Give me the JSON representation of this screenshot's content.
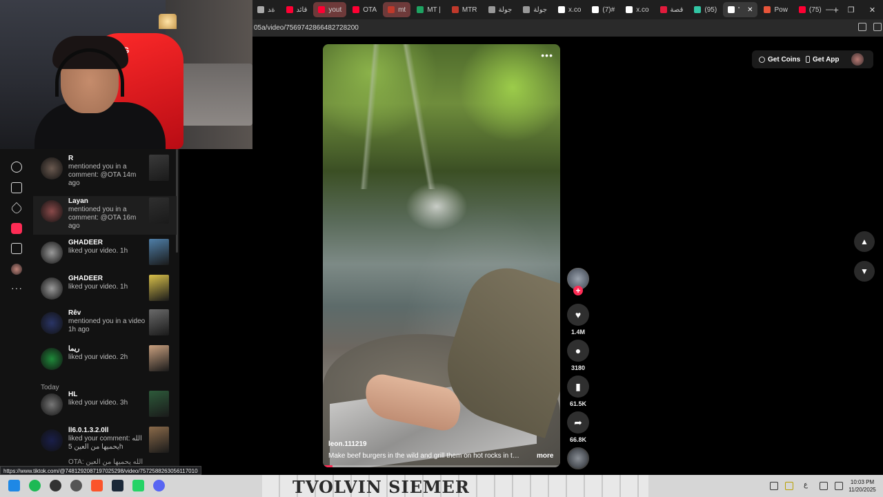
{
  "browser": {
    "tabs": [
      {
        "label": "ﺓﺪ",
        "fav": "#aaaaaa"
      },
      {
        "label": "قائد",
        "fav": "#ff0033"
      },
      {
        "label": "yout",
        "fav": "#ff0033",
        "highlight": true
      },
      {
        "label": "OTA",
        "fav": "#ff0033"
      },
      {
        "label": "mt",
        "fav": "#c0392b",
        "highlight": true
      },
      {
        "label": "MT |",
        "fav": "#1ea362"
      },
      {
        "label": "MTR",
        "fav": "#c0392b"
      },
      {
        "label": "جولة",
        "fav": "#999999"
      },
      {
        "label": "جولة",
        "fav": "#999999"
      },
      {
        "label": "x.co",
        "fav": "#ffffff"
      },
      {
        "label": "(7)#",
        "fav": "#ffffff"
      },
      {
        "label": "x.co",
        "fav": "#ffffff"
      },
      {
        "label": "قصة",
        "fav": "#e21b3c"
      },
      {
        "label": "(95)",
        "fav": "#32c6a4"
      },
      {
        "label": "'",
        "fav": "#ffffff",
        "active": true
      },
      {
        "label": "Pow",
        "fav": "#e8553a"
      },
      {
        "label": "(75)",
        "fav": "#ff0033"
      }
    ],
    "new_tab": "+",
    "url": "05a/video/7569742866482728200",
    "status_url": "https://www.tiktok.com/@7481292087197025298/video/7572588263056117010"
  },
  "inbox": {
    "section_today": "Today",
    "items": [
      {
        "name": "R",
        "text": "mentioned you in a comment: @OTA 14m ago",
        "avatar": "#6b5a50",
        "thumb": "#3a3a3a"
      },
      {
        "name": "Layan",
        "text": "mentioned you in a comment: @OTA 16m ago",
        "avatar": "#8a4a4a",
        "thumb": "#2f2f2f"
      },
      {
        "name": "GHADEER",
        "text": "liked your video. 1h",
        "avatar": "#9a9a9a",
        "thumb": "#4f7fa8"
      },
      {
        "name": "GHADEER",
        "text": "liked your video. 1h",
        "avatar": "#9a9a9a",
        "thumb": "#d8c04a"
      },
      {
        "name": "Rêv",
        "text": "mentioned you in a video 1h ago",
        "avatar": "#2a3566",
        "thumb": "#6a6a6a"
      },
      {
        "name": "ريما",
        "text": "liked your video. 2h",
        "avatar": "#1f8a3a",
        "thumb": "#c9a07f"
      },
      {
        "name": "HL",
        "text": "liked your video. 3h",
        "avatar": "#777777",
        "thumb": "#2d5a3a"
      },
      {
        "name": "ll6.0.1.3.2.0ll",
        "text": "liked your comment: الله يحميها من العين 5h",
        "avatar": "#1a1f4a",
        "thumb": "#8a6a4a"
      }
    ],
    "partial_reply": "OTA: الله يحميها من العين"
  },
  "video": {
    "author": "leon.111219",
    "caption": "Make beef burgers in the wild and grill them on hot rocks in the ...",
    "more": "more",
    "more_menu": "•••",
    "progress": 0.04
  },
  "actions": {
    "likes": "1.4M",
    "comments": "3180",
    "saves": "61.5K",
    "shares": "66.8K"
  },
  "header": {
    "get_coins": "Get Coins",
    "get_app": "Get App"
  },
  "webcam": {
    "chair_logo": "VEG"
  },
  "taskbar": {
    "banner_text": "TVOLVIN    SIEMER",
    "lang": "ع",
    "time": "10:03 PM",
    "date": "11/20/2025"
  },
  "colors": {
    "accent": "#fe2c55",
    "panel": "#121212",
    "background": "#000000"
  }
}
